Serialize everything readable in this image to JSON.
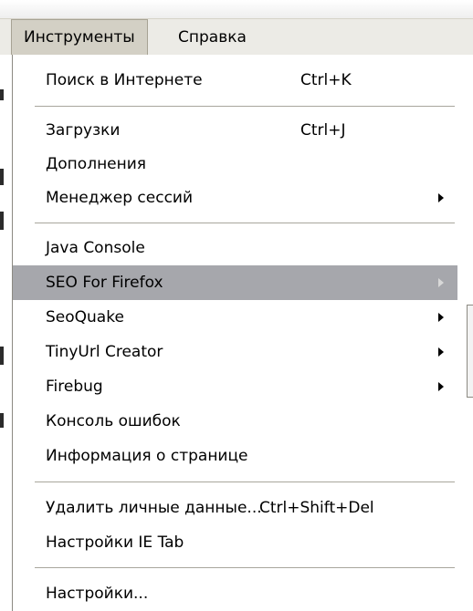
{
  "menubar": {
    "tools": "Инструменты",
    "help": "Справка"
  },
  "menu": {
    "items": [
      {
        "label": "Поиск в Интернете",
        "shortcut": "Ctrl+K"
      },
      {
        "label": "Загрузки",
        "shortcut": "Ctrl+J"
      },
      {
        "label": "Дополнения"
      },
      {
        "label": "Менеджер сессий",
        "submenu": true
      },
      {
        "label": "Java Console"
      },
      {
        "label": "SEO For Firefox",
        "submenu": true,
        "highlighted": true
      },
      {
        "label": "SeoQuake",
        "submenu": true
      },
      {
        "label": "TinyUrl Creator",
        "submenu": true
      },
      {
        "label": "Firebug",
        "submenu": true
      },
      {
        "label": "Консоль ошибок"
      },
      {
        "label": "Информация о странице"
      },
      {
        "label": "Удалить личные данные...",
        "shortcut": "Ctrl+Shift+Del"
      },
      {
        "label": "Настройки IE Tab"
      },
      {
        "label": "Настройки..."
      }
    ]
  },
  "colors": {
    "menubar_bg": "#ecebe6",
    "highlight_bg": "#a6a7ac",
    "separator": "#a8a69c"
  },
  "icons": {
    "submenu_arrow": "chevron-right-icon"
  }
}
